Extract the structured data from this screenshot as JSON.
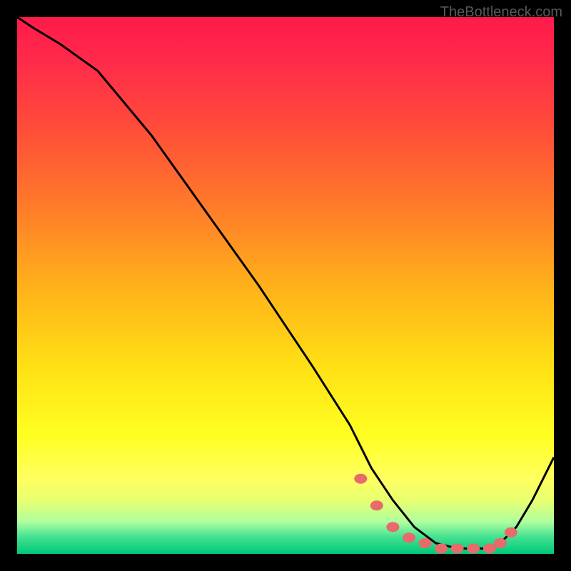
{
  "watermark": "TheBottleneck.com",
  "chart_data": {
    "type": "line",
    "title": "",
    "xlabel": "",
    "ylabel": "",
    "xlim": [
      0,
      100
    ],
    "ylim": [
      0,
      100
    ],
    "series": [
      {
        "name": "curve",
        "x": [
          0,
          3,
          8,
          15,
          25,
          35,
          45,
          55,
          62,
          66,
          70,
          74,
          78,
          82,
          86,
          88,
          90,
          93,
          96,
          100
        ],
        "values": [
          100,
          98,
          95,
          90,
          78,
          64,
          50,
          35,
          24,
          16,
          10,
          5,
          2,
          1,
          1,
          1,
          2,
          5,
          10,
          18
        ]
      }
    ],
    "markers": {
      "name": "flat-region-dots",
      "x": [
        64,
        67,
        70,
        73,
        76,
        79,
        82,
        85,
        88,
        90,
        92
      ],
      "values": [
        14,
        9,
        5,
        3,
        2,
        1,
        1,
        1,
        1,
        2,
        4
      ]
    },
    "colors": {
      "curve": "#000000",
      "markers": "#e86a6a"
    }
  }
}
